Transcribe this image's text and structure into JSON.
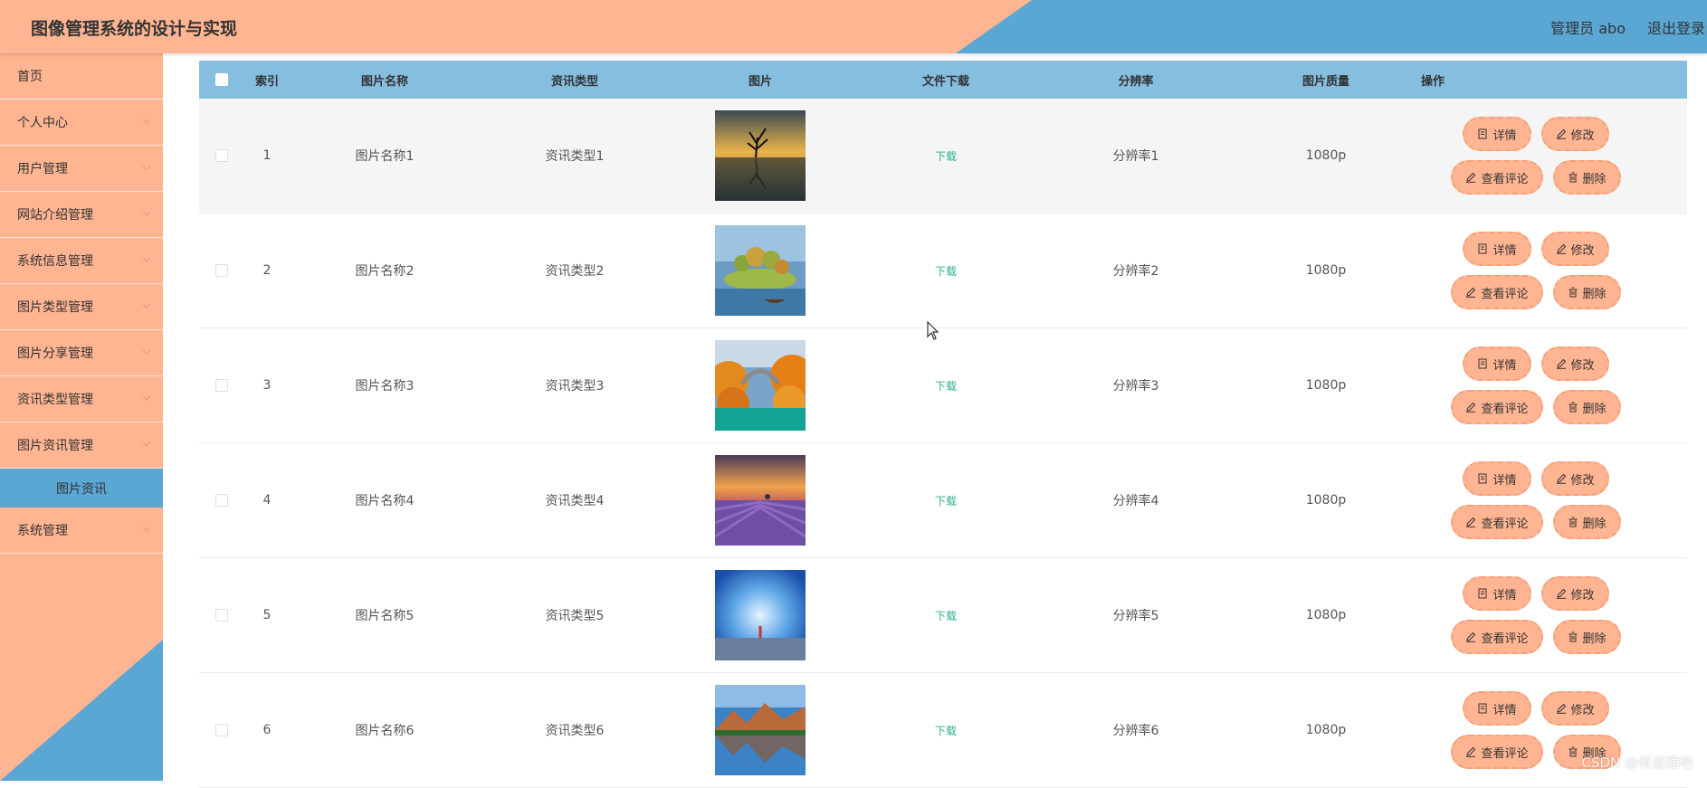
{
  "header": {
    "title": "图像管理系统的设计与实现",
    "user_label": "管理员 abo",
    "logout_label": "退出登录"
  },
  "sidebar": {
    "items": [
      {
        "label": "首页",
        "has_chevron": false
      },
      {
        "label": "个人中心",
        "has_chevron": true
      },
      {
        "label": "用户管理",
        "has_chevron": true
      },
      {
        "label": "网站介绍管理",
        "has_chevron": true
      },
      {
        "label": "系统信息管理",
        "has_chevron": true
      },
      {
        "label": "图片类型管理",
        "has_chevron": true
      },
      {
        "label": "图片分享管理",
        "has_chevron": true
      },
      {
        "label": "资讯类型管理",
        "has_chevron": true
      },
      {
        "label": "图片资讯管理",
        "has_chevron": true
      }
    ],
    "active_sub": "图片资讯",
    "last_item": "系统管理"
  },
  "table": {
    "headers": {
      "index": "索引",
      "name": "图片名称",
      "type": "资讯类型",
      "image": "图片",
      "download": "文件下载",
      "resolution": "分辨率",
      "quality": "图片质量",
      "actions": "操作"
    },
    "rows": [
      {
        "index": "1",
        "name": "图片名称1",
        "type": "资讯类型1",
        "download": "下载",
        "resolution": "分辨率1",
        "quality": "1080p",
        "image": "tree-lake-sunset"
      },
      {
        "index": "2",
        "name": "图片名称2",
        "type": "资讯类型2",
        "download": "下载",
        "resolution": "分辨率2",
        "quality": "1080p",
        "image": "island-trees-boat"
      },
      {
        "index": "3",
        "name": "图片名称3",
        "type": "资讯类型3",
        "download": "下载",
        "resolution": "分辨率3",
        "quality": "1080p",
        "image": "autumn-bridge"
      },
      {
        "index": "4",
        "name": "图片名称4",
        "type": "资讯类型4",
        "download": "下载",
        "resolution": "分辨率4",
        "quality": "1080p",
        "image": "lavender-field"
      },
      {
        "index": "5",
        "name": "图片名称5",
        "type": "资讯类型5",
        "download": "下载",
        "resolution": "分辨率5",
        "quality": "1080p",
        "image": "blue-sky-figure"
      },
      {
        "index": "6",
        "name": "图片名称6",
        "type": "资讯类型6",
        "download": "下载",
        "resolution": "分辨率6",
        "quality": "1080p",
        "image": "mountain-reflection"
      }
    ],
    "actions": {
      "detail": "详情",
      "edit": "修改",
      "comments": "查看评论",
      "delete": "删除"
    }
  },
  "watermark": "CSDN @蒋道理吧",
  "colors": {
    "peach": "#ffb592",
    "blue": "#5aa7d4",
    "table_header": "#86bee0",
    "download_green": "#2fae8f"
  }
}
